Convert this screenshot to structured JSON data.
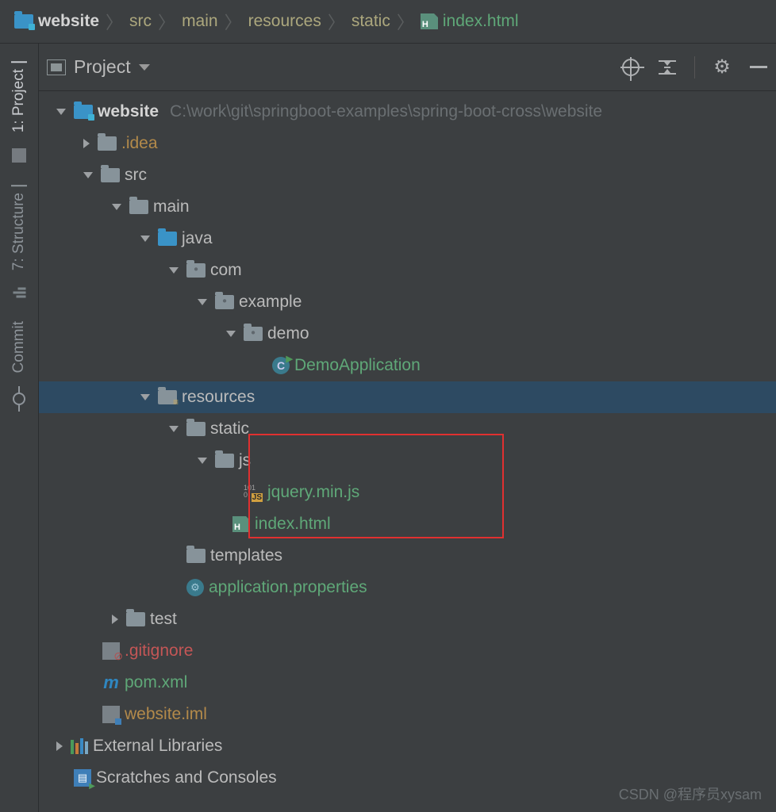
{
  "breadcrumb": [
    "website",
    "src",
    "main",
    "resources",
    "static",
    "index.html"
  ],
  "panel": {
    "title": "Project"
  },
  "sidebar_tabs": {
    "project": "1: Project",
    "structure": "7: Structure",
    "commit": "Commit"
  },
  "tree": {
    "root_name": "website",
    "root_path": "C:\\work\\git\\springboot-examples\\spring-boot-cross\\website",
    "idea": ".idea",
    "src": "src",
    "main": "main",
    "java": "java",
    "com": "com",
    "example": "example",
    "demo": "demo",
    "demo_app": "DemoApplication",
    "resources": "resources",
    "static": "static",
    "js": "js",
    "jquery": "jquery.min.js",
    "index": "index.html",
    "templates": "templates",
    "app_props": "application.properties",
    "test": "test",
    "gitignore": ".gitignore",
    "pom": "pom.xml",
    "iml": "website.iml",
    "ext_libs": "External Libraries",
    "scratches": "Scratches and Consoles"
  },
  "icons": {
    "class_letter": "C",
    "pom_letter": "m"
  },
  "watermark": "CSDN @程序员xysam"
}
